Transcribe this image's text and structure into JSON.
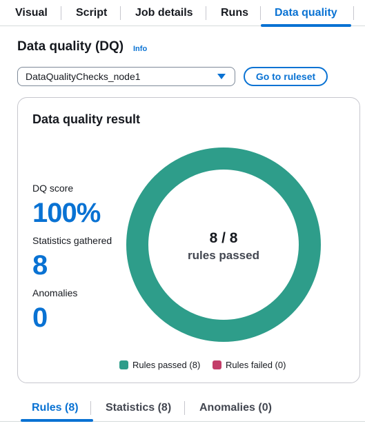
{
  "top_tabs": [
    {
      "label": "Visual",
      "active": false
    },
    {
      "label": "Script",
      "active": false
    },
    {
      "label": "Job details",
      "active": false
    },
    {
      "label": "Runs",
      "active": false
    },
    {
      "label": "Data quality",
      "active": true
    }
  ],
  "header": {
    "title": "Data quality (DQ)",
    "info_label": "Info"
  },
  "node_select": {
    "value": "DataQualityChecks_node1"
  },
  "ruleset_button": {
    "label": "Go to ruleset"
  },
  "result_card": {
    "title": "Data quality result",
    "dq_score_label": "DQ score",
    "dq_score_value": "100%",
    "stats_label": "Statistics gathered",
    "stats_value": "8",
    "anomalies_label": "Anomalies",
    "anomalies_value": "0"
  },
  "chart_data": {
    "type": "pie",
    "donut": true,
    "center_value": "8 / 8",
    "center_label": "rules passed",
    "slices": [
      {
        "name": "Rules passed (8)",
        "value": 8,
        "color": "#2e9d8a"
      },
      {
        "name": "Rules failed (0)",
        "value": 0,
        "color": "#c33d69"
      }
    ]
  },
  "bottom_tabs": [
    {
      "label": "Rules (8)",
      "active": true
    },
    {
      "label": "Statistics (8)",
      "active": false
    },
    {
      "label": "Anomalies (0)",
      "active": false
    }
  ]
}
